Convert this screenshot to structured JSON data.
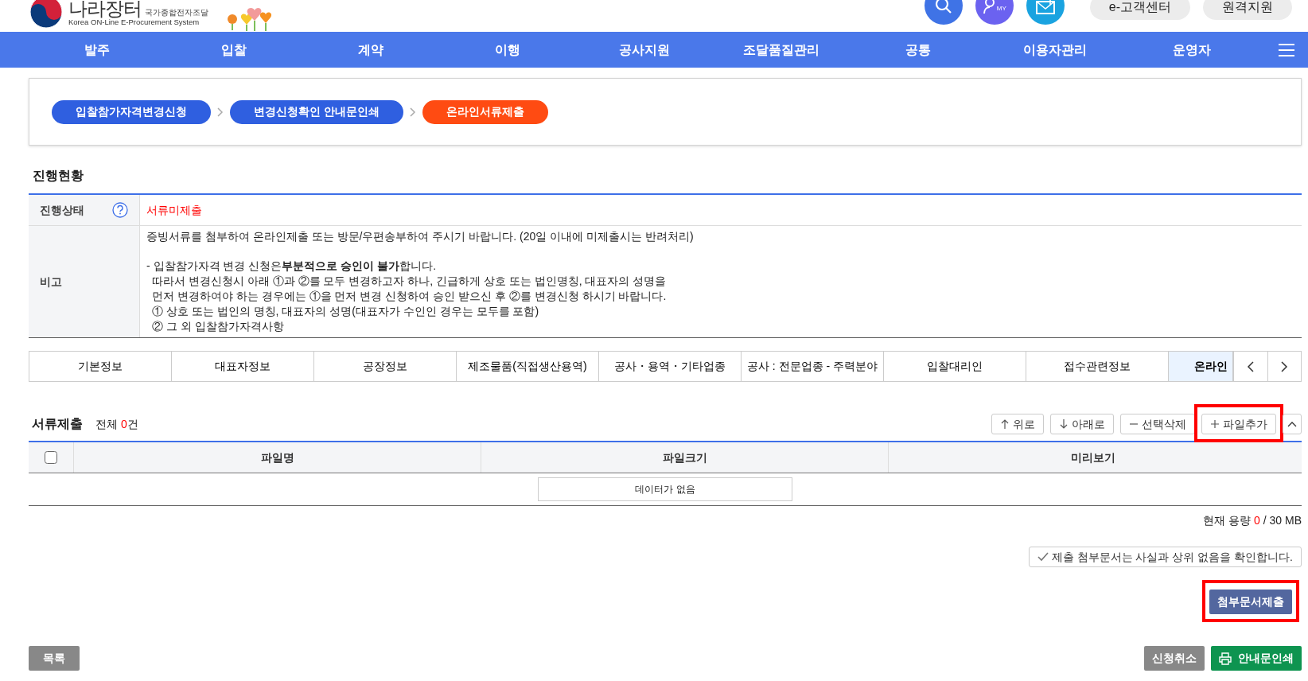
{
  "header": {
    "logo_title": "나라장터",
    "logo_subtitle": "국가종합전자조달",
    "logo_english": "Korea ON-Line E-Procurement System",
    "my_label": "MY",
    "utility_buttons": [
      "e-고객센터",
      "원격지원"
    ]
  },
  "nav": [
    "발주",
    "입찰",
    "계약",
    "이행",
    "공사지원",
    "조달품질관리",
    "공통",
    "이용자관리",
    "운영자"
  ],
  "steps": [
    {
      "label": "입찰참가자격변경신청",
      "selected": false
    },
    {
      "label": "변경신청확인 안내문인쇄",
      "selected": false
    },
    {
      "label": "온라인서류제출",
      "selected": true
    }
  ],
  "section_title": "진행현황",
  "status": {
    "label": "진행상태",
    "value": "서류미제출"
  },
  "remarks": {
    "label": "비고",
    "paragraphs": [
      [
        "증빙서류를 첨부하여 온라인제출 또는 방문/우편송부하여 주시기 바랍니다. (20일 이내에 미제출시는 반려처리)"
      ],
      [
        "- 입찰참가자격 변경 신청은**부분적으로 승인이 불가**합니다.",
        "따라서 변경신청시 아래 ①과 ②를 모두 변경하고자 하나, 긴급하게 상호 또는 법인명칭, 대표자의 성명을",
        "먼저 변경하여야 하는 경우에는 ①을 먼저 변경 신청하여 승인 받으신 후 ②를 변경신청 하시기 바랍니다.",
        "① 상호 또는 법인의 명칭, 대표자의 성명(대표자가 수인인 경우는 모두를 포함)",
        "② 그 외 입찰참가자격사항"
      ]
    ]
  },
  "tabs": [
    {
      "label": "기본정보",
      "selected": false
    },
    {
      "label": "대표자정보",
      "selected": false
    },
    {
      "label": "공장정보",
      "selected": false
    },
    {
      "label": "제조물품(직접생산용역)",
      "selected": false
    },
    {
      "label": "공사・용역・기타업종",
      "selected": false
    },
    {
      "label": "공사 : 전문업종 - 주력분야",
      "selected": false
    },
    {
      "label": "입찰대리인",
      "selected": false
    },
    {
      "label": "접수관련정보",
      "selected": false
    },
    {
      "label": "온라인",
      "selected": true
    }
  ],
  "files": {
    "title": "서류제출",
    "total_label": "전체",
    "count": "0",
    "count_suffix": "건",
    "buttons": [
      {
        "kind": "up",
        "label": "위로",
        "highlighted": false
      },
      {
        "kind": "down",
        "label": "아래로",
        "highlighted": false
      },
      {
        "kind": "delete",
        "label": "선택삭제",
        "highlighted": false
      },
      {
        "kind": "add",
        "label": "파일추가",
        "highlighted": true
      }
    ],
    "select_all": {
      "checked": false
    },
    "columns": [
      "파일명",
      "파일크기",
      "미리보기"
    ],
    "empty_text": "데이터가 없음",
    "usage_label": "현재 용량",
    "usage_value": "0",
    "usage_total": "/ 30 MB"
  },
  "confirm_label": "제출 첨부문서는 사실과 상위 없음을 확인합니다.",
  "submit_button": {
    "label": "첨부문서제출",
    "highlighted": true
  },
  "footer": {
    "list_button": "목록",
    "cancel_button": "신청취소",
    "print_button": "안내문인쇄"
  }
}
